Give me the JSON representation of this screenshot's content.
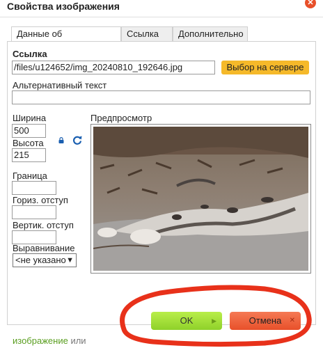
{
  "dialog": {
    "title": "Свойства изображения",
    "close_glyph": "✕"
  },
  "tabs": [
    {
      "label": "Данные об изображении",
      "active": true
    },
    {
      "label": "Ссылка",
      "active": false
    },
    {
      "label": "Дополнительно",
      "active": false
    }
  ],
  "form": {
    "url_label": "Ссылка",
    "url_value": "/files/u124652/img_20240810_192646.jpg",
    "browse_server_label": "Выбор на сервере",
    "alt_label": "Альтернативный текст",
    "alt_value": "",
    "width_label": "Ширина",
    "width_value": "500",
    "height_label": "Высота",
    "height_value": "215",
    "border_label": "Граница",
    "border_value": "",
    "hspace_label": "Гориз. отступ",
    "hspace_value": "",
    "vspace_label": "Вертик. отступ",
    "vspace_value": "",
    "align_label": "Выравнивание",
    "align_value": "<не указано"
  },
  "preview": {
    "label": "Предпросмотр"
  },
  "buttons": {
    "ok_label": "OK",
    "cancel_label": "Отмена"
  },
  "background_text": {
    "link": "изображение",
    "rest": "или"
  },
  "colors": {
    "ok_button": "#a6e03a",
    "cancel_button": "#ef6640",
    "browse_button": "#f5b92a",
    "annotation": "#e8311a"
  }
}
